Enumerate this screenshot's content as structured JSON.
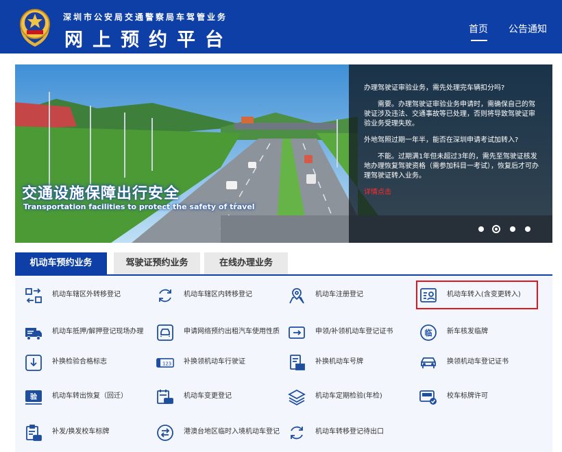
{
  "header": {
    "subtitle": "深圳市公安局交通警察局车驾管业务",
    "title": "网上预约平台",
    "nav": {
      "home": "首页",
      "notice": "公告通知"
    }
  },
  "banner": {
    "slogan_cn": "交通设施保障出行安全",
    "slogan_en": "Transportation facilities to protect the safety of travel",
    "faq": {
      "q1": "办理驾驶证审验业务，需先处理完车辆扣分吗?",
      "a1": "需要。办理驾驶证审验业务申请时，需确保自己的驾驶证涉及违法、交通事故等已处理，否则将导致驾驶证审验业务受理失败。",
      "q2": "外地驾照过期一年半，能否在深圳申请考试加转入?",
      "a2": "不能。过期满1年但未超过3年的，需先至驾驶证核发地办理恢复驾驶资格（需参加科目一考试），恢复后才可办理驾驶证转入业务。",
      "more": "详情点击"
    },
    "slides": 4,
    "active_slide": 2
  },
  "tabs": [
    "机动车预约业务",
    "驾驶证预约业务",
    "在线办理业务"
  ],
  "services": [
    {
      "label": "机动车辖区外转移登记",
      "icon": "transfer-arrows-icon"
    },
    {
      "label": "机动车辖区内转移登记",
      "icon": "refresh-cycle-icon"
    },
    {
      "label": "机动车注册登记",
      "icon": "map-pin-icon"
    },
    {
      "label": "机动车转入(含变更转入)",
      "icon": "person-card-icon"
    },
    {
      "label": "机动车抵押/解押登记现场办理",
      "icon": "truck-icon"
    },
    {
      "label": "申请网络预约出租汽车使用性质",
      "icon": "car-circle-icon"
    },
    {
      "label": "申领/补领机动车登记证书",
      "icon": "certificate-arrow-icon"
    },
    {
      "label": "新车核发临牌",
      "icon": "temp-plate-icon"
    },
    {
      "label": "补换检验合格标志",
      "icon": "download-box-icon"
    },
    {
      "label": "补换领机动车行驶证",
      "icon": "license-number-icon"
    },
    {
      "label": "补换机动车号牌",
      "icon": "plate-document-icon"
    },
    {
      "label": "换领机动车登记证书",
      "icon": "car-front-icon"
    },
    {
      "label": "机动车转出恢复（回迁）",
      "icon": "inspection-badge-icon"
    },
    {
      "label": "机动车变更登记",
      "icon": "calendar-car-icon"
    },
    {
      "label": "机动车定期检验(年检)",
      "icon": "layers-icon"
    },
    {
      "label": "校车标牌许可",
      "icon": "bus-check-icon"
    },
    {
      "label": "补发/换发校车标牌",
      "icon": "clipboard-car-icon"
    },
    {
      "label": "港澳台地区临时入境机动车登记",
      "icon": "swap-circle-icon"
    },
    {
      "label": "机动车转移登记待出口",
      "icon": "refresh-export-icon"
    }
  ],
  "colors": {
    "primary": "#0d3fa6",
    "highlight": "#e0161b",
    "grid_bg": "#f3f7fd",
    "icon": "#1f4e9e"
  }
}
